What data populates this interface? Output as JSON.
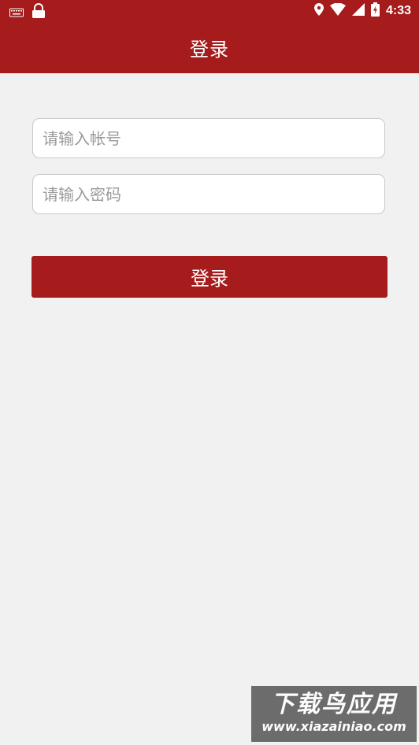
{
  "status_bar": {
    "time": "4:33",
    "icons": [
      "keyboard-icon",
      "lock-icon",
      "location-icon",
      "wifi-icon",
      "signal-icon",
      "battery-charging-icon"
    ]
  },
  "app_bar": {
    "title": "登录"
  },
  "form": {
    "account_placeholder": "请输入帐号",
    "password_placeholder": "请输入密码",
    "login_label": "登录"
  },
  "watermark": {
    "title": "下载鸟应用",
    "url": "www.xiazainiao.com"
  },
  "colors": {
    "primary": "#a61b1b",
    "background": "#f1f1f1"
  }
}
